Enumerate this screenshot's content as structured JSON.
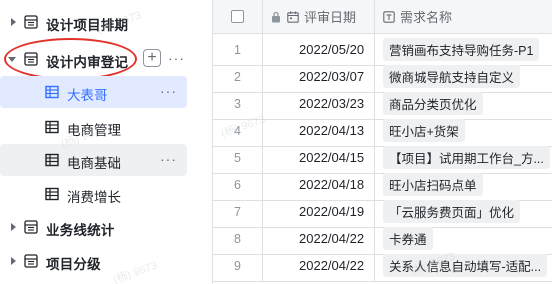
{
  "sidebar": {
    "items": [
      {
        "label": "设计项目排期"
      },
      {
        "label": "设计内审登记"
      },
      {
        "label": "大表哥"
      },
      {
        "label": "电商管理"
      },
      {
        "label": "电商基础"
      },
      {
        "label": "消费增长"
      },
      {
        "label": "业务线统计"
      },
      {
        "label": "项目分级"
      }
    ],
    "add_symbol": "+",
    "more_symbol": "···"
  },
  "table": {
    "columns": [
      "",
      "评审日期",
      "需求名称"
    ],
    "rows": [
      {
        "num": "1",
        "date": "2022/05/20",
        "name": "营销画布支持导购任务-P1"
      },
      {
        "num": "2",
        "date": "2022/03/07",
        "name": "微商城导航支持自定义"
      },
      {
        "num": "3",
        "date": "2022/03/23",
        "name": "商品分类页优化"
      },
      {
        "num": "4",
        "date": "2022/04/13",
        "name": "旺小店+货架"
      },
      {
        "num": "5",
        "date": "2022/04/15",
        "name": "【项目】试用期工作台_方..."
      },
      {
        "num": "6",
        "date": "2022/04/18",
        "name": "旺小店扫码点单"
      },
      {
        "num": "7",
        "date": "2022/04/19",
        "name": "「云服务费页面」优化"
      },
      {
        "num": "8",
        "date": "2022/04/22",
        "name": "卡券通"
      },
      {
        "num": "9",
        "date": "2022/04/22",
        "name": "关系人信息自动填写-适配..."
      }
    ]
  },
  "watermark": {
    "text": "(杨) 9673"
  },
  "colors": {
    "accent": "#3370ff",
    "highlight_circle": "#e1332b",
    "active_bg": "#e1eaff"
  }
}
